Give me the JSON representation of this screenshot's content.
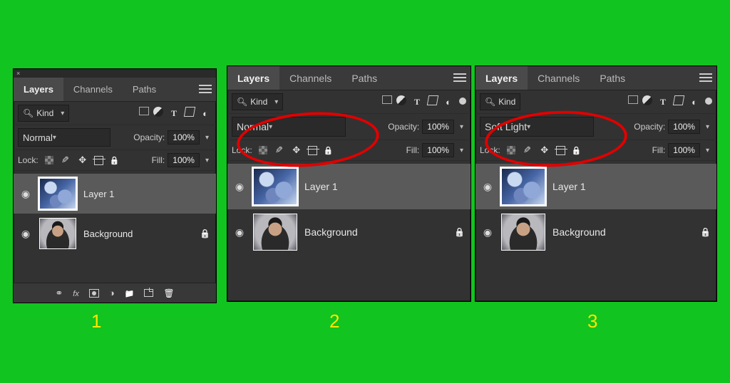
{
  "steps": {
    "s1": "1",
    "s2": "2",
    "s3": "3"
  },
  "tabs": {
    "layers": "Layers",
    "channels": "Channels",
    "paths": "Paths"
  },
  "filter_label": "Kind",
  "blend": {
    "p1": "Normal",
    "p2": "Normal",
    "p3": "Soft Light"
  },
  "opacity_label": "Opacity:",
  "opacity_value": "100%",
  "lock_label": "Lock:",
  "fill_label": "Fill:",
  "fill_value": "100%",
  "layers": {
    "l1": "Layer 1",
    "bg": "Background"
  }
}
